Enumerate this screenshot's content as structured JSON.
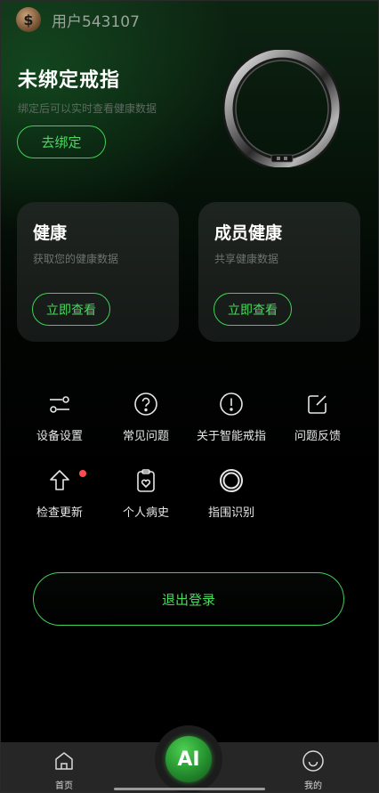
{
  "header": {
    "avatar_glyph": "$",
    "username": "用户543107"
  },
  "binding": {
    "title": "未绑定戒指",
    "subtitle": "绑定后可以实时查看健康数据",
    "button_label": "去绑定"
  },
  "cards": [
    {
      "title": "健康",
      "subtitle": "获取您的健康数据",
      "button_label": "立即查看"
    },
    {
      "title": "成员健康",
      "subtitle": "共享健康数据",
      "button_label": "立即查看"
    }
  ],
  "functions": [
    {
      "label": "设备设置",
      "icon": "sliders-icon"
    },
    {
      "label": "常见问题",
      "icon": "question-circle-icon"
    },
    {
      "label": "关于智能戒指",
      "icon": "exclamation-circle-icon"
    },
    {
      "label": "问题反馈",
      "icon": "edit-icon"
    },
    {
      "label": "检查更新",
      "icon": "arrow-up-icon",
      "badge": true
    },
    {
      "label": "个人病史",
      "icon": "clipboard-heart-icon"
    },
    {
      "label": "指围识别",
      "icon": "ring-icon"
    }
  ],
  "logout_label": "退出登录",
  "nav": {
    "home_label": "首页",
    "ai_label": "AI",
    "mine_label": "我的"
  },
  "colors": {
    "accent": "#49d95d",
    "badge": "#ff4d4f",
    "nav_bg": "#262626"
  }
}
